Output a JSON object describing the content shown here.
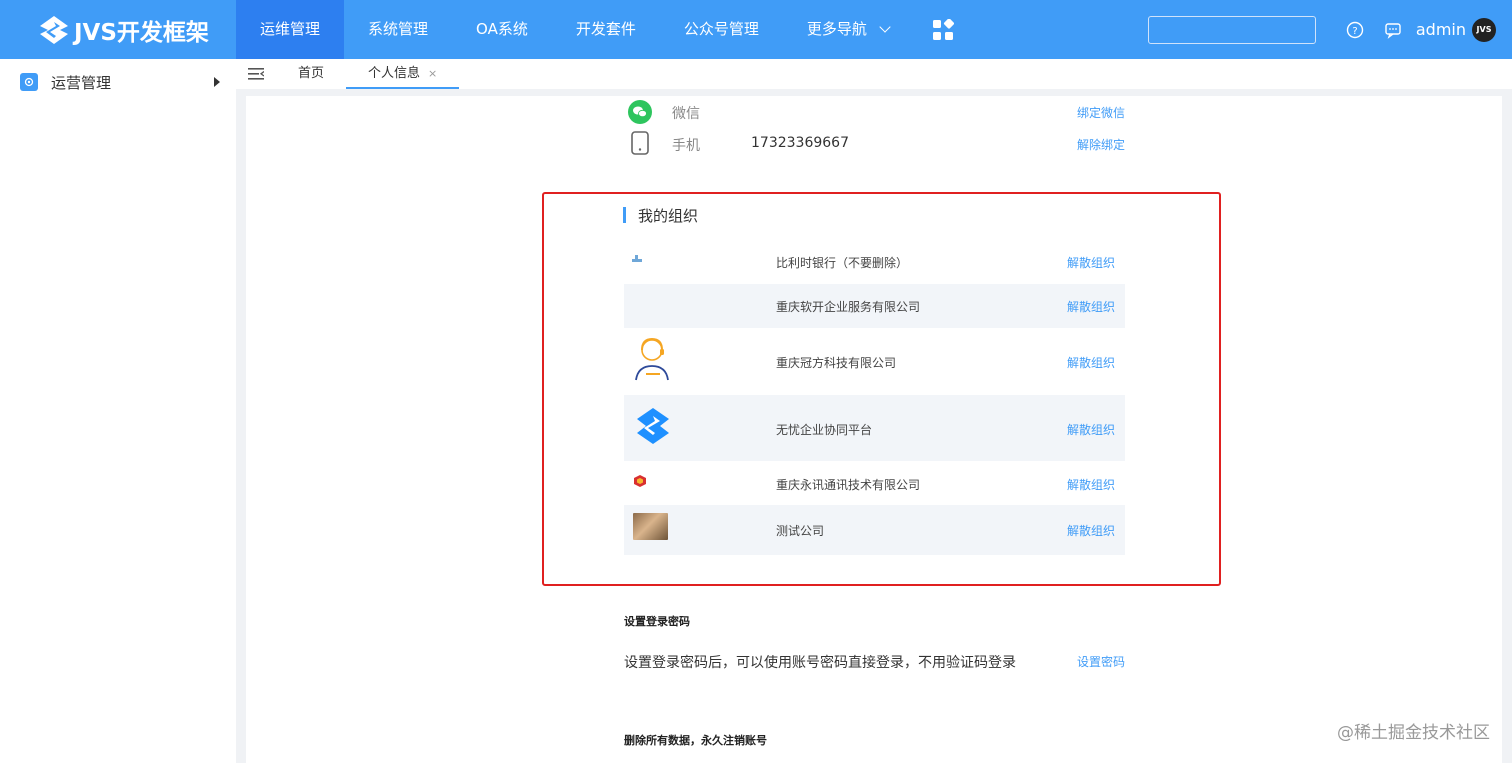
{
  "app": {
    "logo_text": "JVS开发框架"
  },
  "nav": {
    "items": [
      "运维管理",
      "系统管理",
      "OA系统",
      "开发套件",
      "公众号管理"
    ],
    "more_label": "更多导航",
    "admin_name": "admin",
    "avatar_text": "JVS"
  },
  "sidebar": {
    "items": [
      {
        "label": "运营管理"
      }
    ]
  },
  "tabs": {
    "home": "首页",
    "active": "个人信息",
    "close_glyph": "×"
  },
  "bindings": {
    "wechat": {
      "label": "微信",
      "action": "绑定微信"
    },
    "phone": {
      "label": "手机",
      "value": "17323369667",
      "action": "解除绑定"
    }
  },
  "orgs": {
    "title": "我的组织",
    "action_label": "解散组织",
    "items": [
      {
        "name": "比利时银行（不要删除）"
      },
      {
        "name": "重庆软开企业服务有限公司"
      },
      {
        "name": "重庆冠方科技有限公司"
      },
      {
        "name": "无忧企业协同平台"
      },
      {
        "name": "重庆永讯通讯技术有限公司"
      },
      {
        "name": "测试公司"
      }
    ]
  },
  "password": {
    "title": "设置登录密码",
    "desc": "设置登录密码后，可以使用账号密码直接登录，不用验证码登录",
    "action": "设置密码"
  },
  "delete": {
    "title": "删除所有数据，永久注销账号"
  },
  "watermark": "@稀土掘金技术社区",
  "colors": {
    "primary": "#409cf7",
    "nav_active": "#2d7ff0",
    "highlight": "#e02020",
    "stripe": "#f2f5f9"
  }
}
